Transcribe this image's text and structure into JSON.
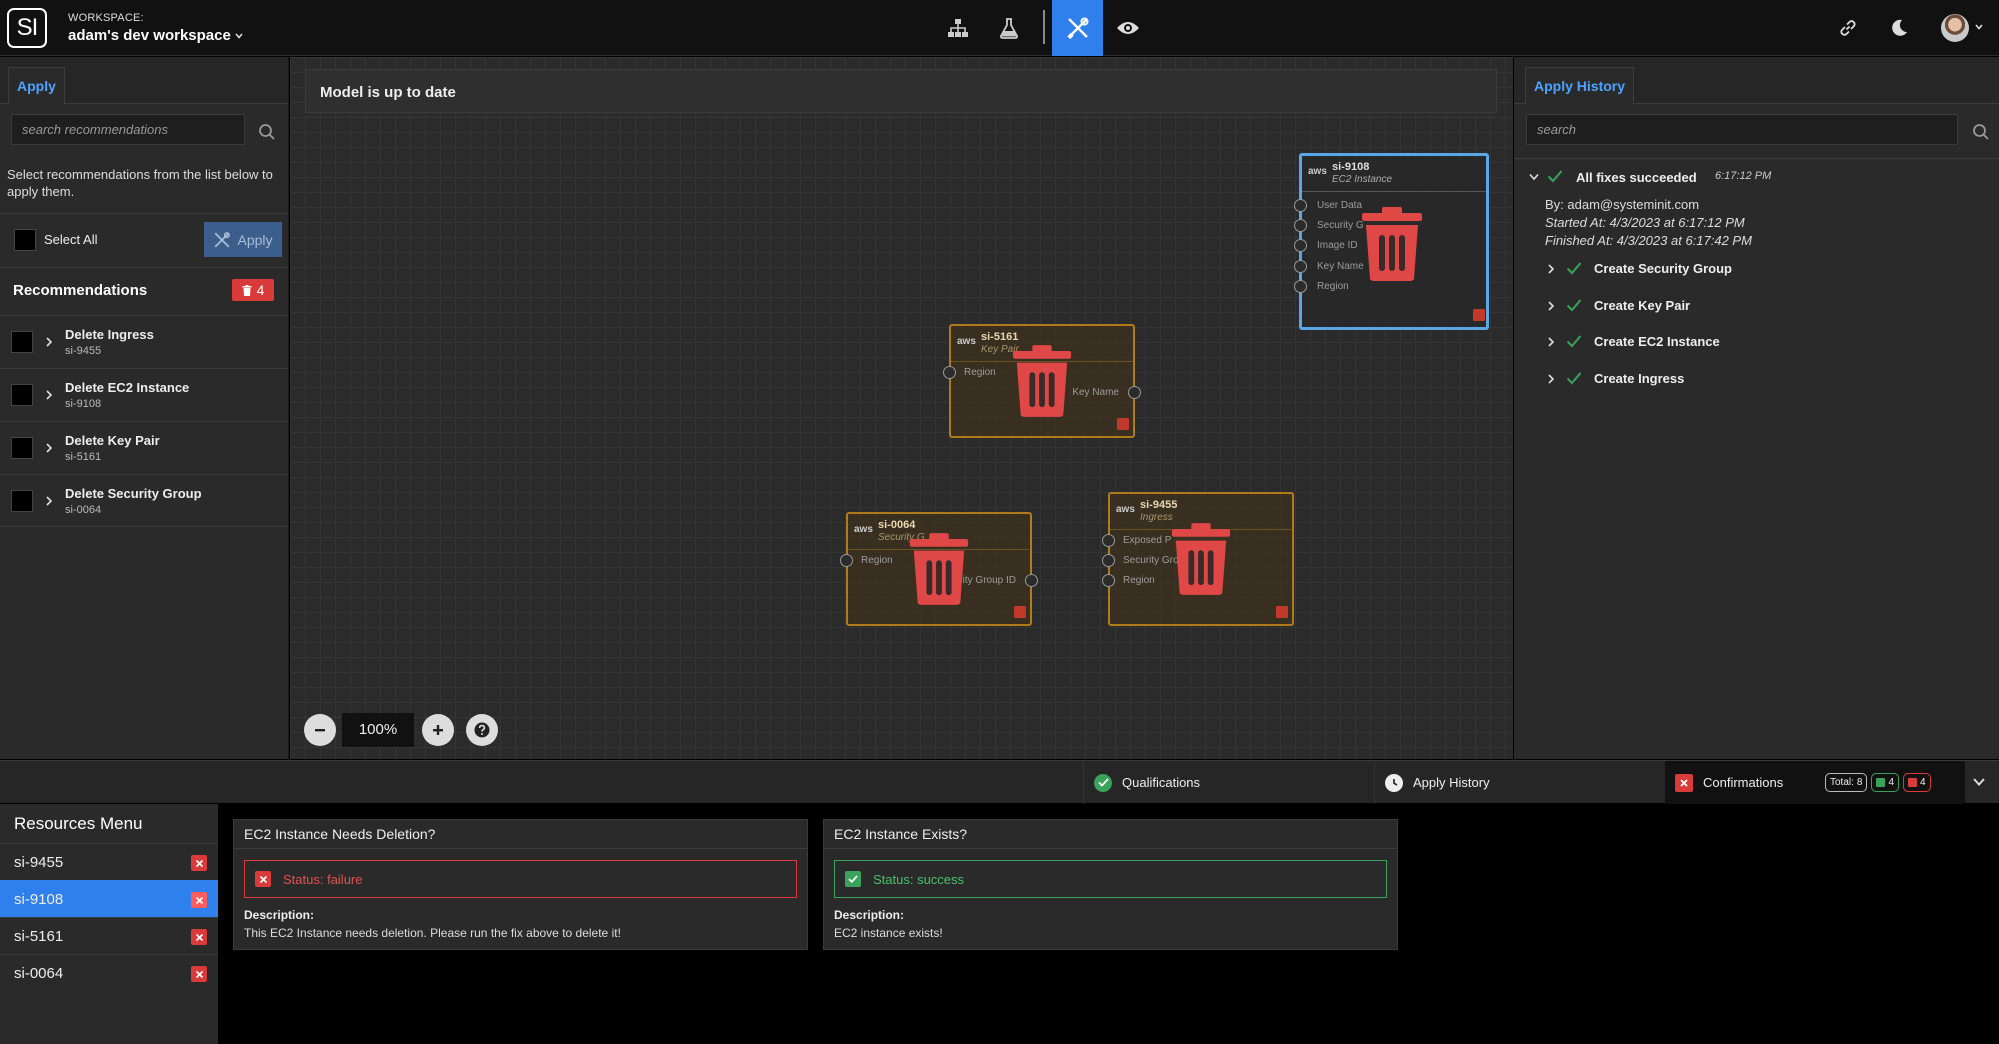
{
  "app": {
    "logo_text": "SI",
    "workspace_label": "WORKSPACE:",
    "workspace_name": "adam's dev workspace"
  },
  "nav": {
    "active": "fix",
    "icons": [
      "diagram-icon",
      "lab-icon",
      "fix-tools-icon",
      "eye-icon"
    ]
  },
  "left_panel": {
    "tab_label": "Apply",
    "search_placeholder": "search recommendations",
    "help_text": "Select recommendations from the list below to apply them.",
    "select_all_label": "Select All",
    "apply_button_label": "Apply",
    "recommendations_title": "Recommendations",
    "recommendations_count": "4",
    "items": [
      {
        "name": "Delete Ingress",
        "id": "si-9455"
      },
      {
        "name": "Delete EC2 Instance",
        "id": "si-9108"
      },
      {
        "name": "Delete Key Pair",
        "id": "si-5161"
      },
      {
        "name": "Delete Security Group",
        "id": "si-0064"
      }
    ]
  },
  "canvas": {
    "status_text": "Model is up to date",
    "zoom_value": "100%",
    "nodes": [
      {
        "id": "si-9108",
        "type": "EC2 Instance",
        "aws": "aws",
        "selected": true,
        "sockets": [
          "User Data",
          "Security G",
          "Image ID",
          "Key Name",
          "Region"
        ]
      },
      {
        "id": "si-5161",
        "type": "Key Pair",
        "aws": "aws",
        "selected": false,
        "inputs": [
          "Region"
        ],
        "outputs": [
          "Key Name"
        ]
      },
      {
        "id": "si-0064",
        "type": "Security G",
        "aws": "aws",
        "selected": false,
        "inputs": [
          "Region"
        ],
        "outputs": [
          "Security Group ID"
        ]
      },
      {
        "id": "si-9455",
        "type": "Ingress",
        "aws": "aws",
        "selected": false,
        "sockets": [
          "Exposed P",
          "Security Group ID",
          "Region"
        ]
      }
    ]
  },
  "right_panel": {
    "tab_label": "Apply History",
    "search_placeholder": "search",
    "history": {
      "title": "All fixes succeeded",
      "time": "6:17:12 PM",
      "by": "By: adam@systeminit.com",
      "started": "Started At: 4/3/2023 at 6:17:12 PM",
      "finished": "Finished At: 4/3/2023 at 6:17:42 PM",
      "actions": [
        "Create Security Group",
        "Create Key Pair",
        "Create EC2 Instance",
        "Create Ingress"
      ]
    }
  },
  "bottom_tabs": {
    "qualifications": "Qualifications",
    "apply_history": "Apply History",
    "confirmations": "Confirmations",
    "total_label": "Total:",
    "total": "8",
    "success_count": "4",
    "failure_count": "4"
  },
  "resources_menu": {
    "title": "Resources Menu",
    "items": [
      "si-9455",
      "si-9108",
      "si-5161",
      "si-0064"
    ],
    "active": "si-9108"
  },
  "confirmations": [
    {
      "title": "EC2 Instance Needs Deletion?",
      "status": "Status: failure",
      "description_label": "Description:",
      "description": "This EC2 Instance needs deletion. Please run the fix above to delete it!"
    },
    {
      "title": "EC2 Instance Exists?",
      "status": "Status: success",
      "description_label": "Description:",
      "description": "EC2 instance exists!"
    }
  ],
  "colors": {
    "accent": "#2f80ed",
    "danger": "#d93b3b",
    "success": "#39a35b",
    "node_border": "#b07c1a"
  }
}
